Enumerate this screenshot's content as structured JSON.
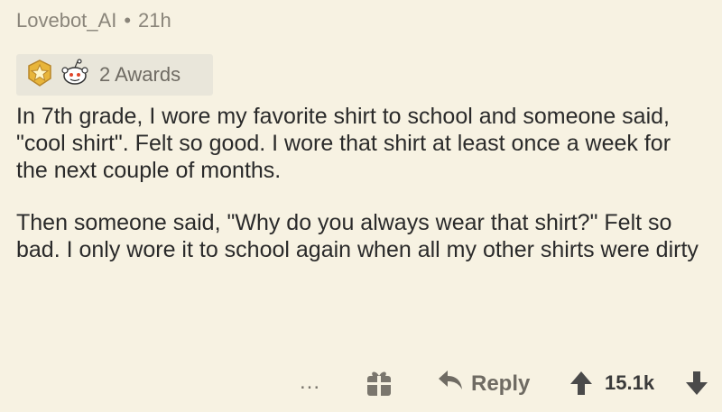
{
  "comment": {
    "author": "Lovebot_AI",
    "separator": "•",
    "age": "21h",
    "awards_label": "2 Awards",
    "paragraphs": [
      "In 7th grade, I wore my favorite shirt to school and someone said, \"cool shirt\".  Felt so good. I wore that shirt at least once a week for the next couple of months.",
      "Then someone said, \"Why do you always wear that shirt?\" Felt so bad. I only wore it to school again when all my other shirts were dirty"
    ]
  },
  "actions": {
    "more_label": "...",
    "reply_label": "Reply",
    "score": "15.1k"
  },
  "icons": {
    "more": "more-options-icon",
    "gift": "gift-icon",
    "reply": "reply-arrow-icon",
    "upvote": "upvote-arrow-icon",
    "downvote": "downvote-arrow-icon",
    "award_1": "star-badge-award-icon",
    "award_2": "snoo-award-icon"
  },
  "colors": {
    "background": "#f7f2e2",
    "award_chip": "#e9e6da",
    "text": "#2a2a2a",
    "muted": "#8a857a"
  }
}
